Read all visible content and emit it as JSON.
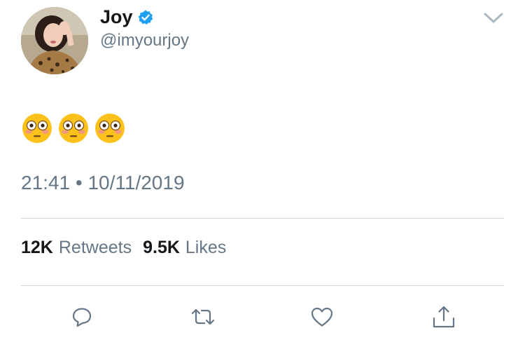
{
  "tweet": {
    "author": {
      "display_name": "Joy",
      "handle": "@imyourjoy",
      "verified": true
    },
    "content_emojis": [
      "flushed-face",
      "flushed-face",
      "flushed-face"
    ],
    "time": "21:41",
    "separator": "•",
    "date": "10/11/2019",
    "stats": {
      "retweets_count": "12K",
      "retweets_label": "Retweets",
      "likes_count": "9.5K",
      "likes_label": "Likes"
    }
  },
  "icons": {
    "verified": "verified-badge-icon",
    "menu": "chevron-down-icon",
    "reply": "reply-icon",
    "retweet": "retweet-icon",
    "like": "heart-icon",
    "share": "share-icon"
  },
  "colors": {
    "accent": "#1da1f2",
    "text_primary": "#14171a",
    "text_secondary": "#657786",
    "divider": "#ccd6dd",
    "icon": "#657786"
  }
}
